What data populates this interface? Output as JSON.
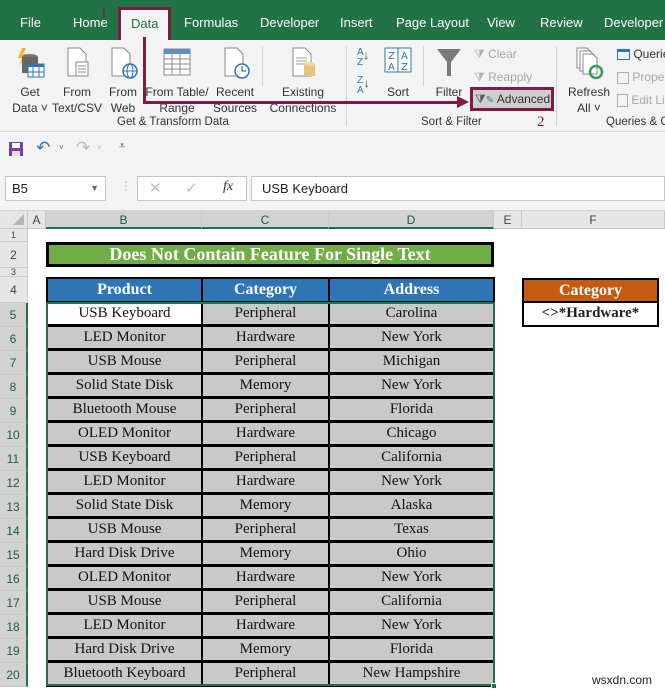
{
  "tabs": [
    {
      "label": "File"
    },
    {
      "label": "Home"
    },
    {
      "label": "Data",
      "active": true
    },
    {
      "label": "Formulas"
    },
    {
      "label": "Developer"
    },
    {
      "label": "Insert"
    },
    {
      "label": "Page Layout"
    },
    {
      "label": "View"
    },
    {
      "label": "Review"
    },
    {
      "label": "Developer"
    }
  ],
  "annotations": {
    "step1": "1",
    "step2": "2"
  },
  "ribbon": {
    "get_transform": {
      "get_data": [
        "Get",
        "Data ˅"
      ],
      "from_text": [
        "From",
        "Text/CSV"
      ],
      "from_web": [
        "From",
        "Web"
      ],
      "from_table": [
        "From Table/",
        "Range"
      ],
      "recent_sources": [
        "Recent",
        "Sources"
      ],
      "existing_connections": [
        "Existing",
        "Connections"
      ],
      "label": "Get & Transform Data"
    },
    "sort_filter": {
      "sort": "Sort",
      "filter": "Filter",
      "clear": "Clear",
      "reapply": "Reapply",
      "advanced": "Advanced",
      "label": "Sort & Filter"
    },
    "queries": {
      "refresh_all": [
        "Refresh",
        "All ˅"
      ],
      "queries": "Queries & Connections",
      "properties": "Properties",
      "edit_links": "Edit Links",
      "label": "Queries & Connections"
    }
  },
  "formula_bar": {
    "name_box": "B5",
    "fx": "fx",
    "value": "USB Keyboard"
  },
  "columns": [
    "A",
    "B",
    "C",
    "D",
    "E",
    "F"
  ],
  "rows": [
    "1",
    "2",
    "3",
    "4",
    "5",
    "6",
    "7",
    "8",
    "9",
    "10",
    "11",
    "12",
    "13",
    "14",
    "15",
    "16",
    "17",
    "18",
    "19",
    "20"
  ],
  "sheet": {
    "title": "Does Not Contain Feature For Single Text",
    "headers": [
      "Product",
      "Category",
      "Address"
    ],
    "data": [
      [
        "USB Keyboard",
        "Peripheral",
        "Carolina"
      ],
      [
        "LED Monitor",
        "Hardware",
        "New York"
      ],
      [
        "USB Mouse",
        "Peripheral",
        "Michigan"
      ],
      [
        "Solid State Disk",
        "Memory",
        "New York"
      ],
      [
        "Bluetooth Mouse",
        "Peripheral",
        "Florida"
      ],
      [
        "OLED Monitor",
        "Hardware",
        "Chicago"
      ],
      [
        "USB Keyboard",
        "Peripheral",
        "California"
      ],
      [
        "LED Monitor",
        "Hardware",
        "New York"
      ],
      [
        "Solid State Disk",
        "Memory",
        "Alaska"
      ],
      [
        "USB Mouse",
        "Peripheral",
        "Texas"
      ],
      [
        "Hard Disk Drive",
        "Memory",
        "Ohio"
      ],
      [
        "OLED Monitor",
        "Hardware",
        "New York"
      ],
      [
        "USB Mouse",
        "Peripheral",
        "California"
      ],
      [
        "LED Monitor",
        "Hardware",
        "New York"
      ],
      [
        "Hard Disk Drive",
        "Memory",
        "Florida"
      ],
      [
        "Bluetooth Keyboard",
        "Peripheral",
        "New Hampshire"
      ]
    ],
    "criteria": {
      "header": "Category",
      "value": "<>*Hardware*"
    }
  },
  "watermark": "wsxdn.com",
  "colors": {
    "excel_green": "#217346",
    "annotation": "#7b1c47",
    "title_green": "#70ad47",
    "header_blue": "#2e75b6",
    "criteria_orange": "#c55a11"
  }
}
